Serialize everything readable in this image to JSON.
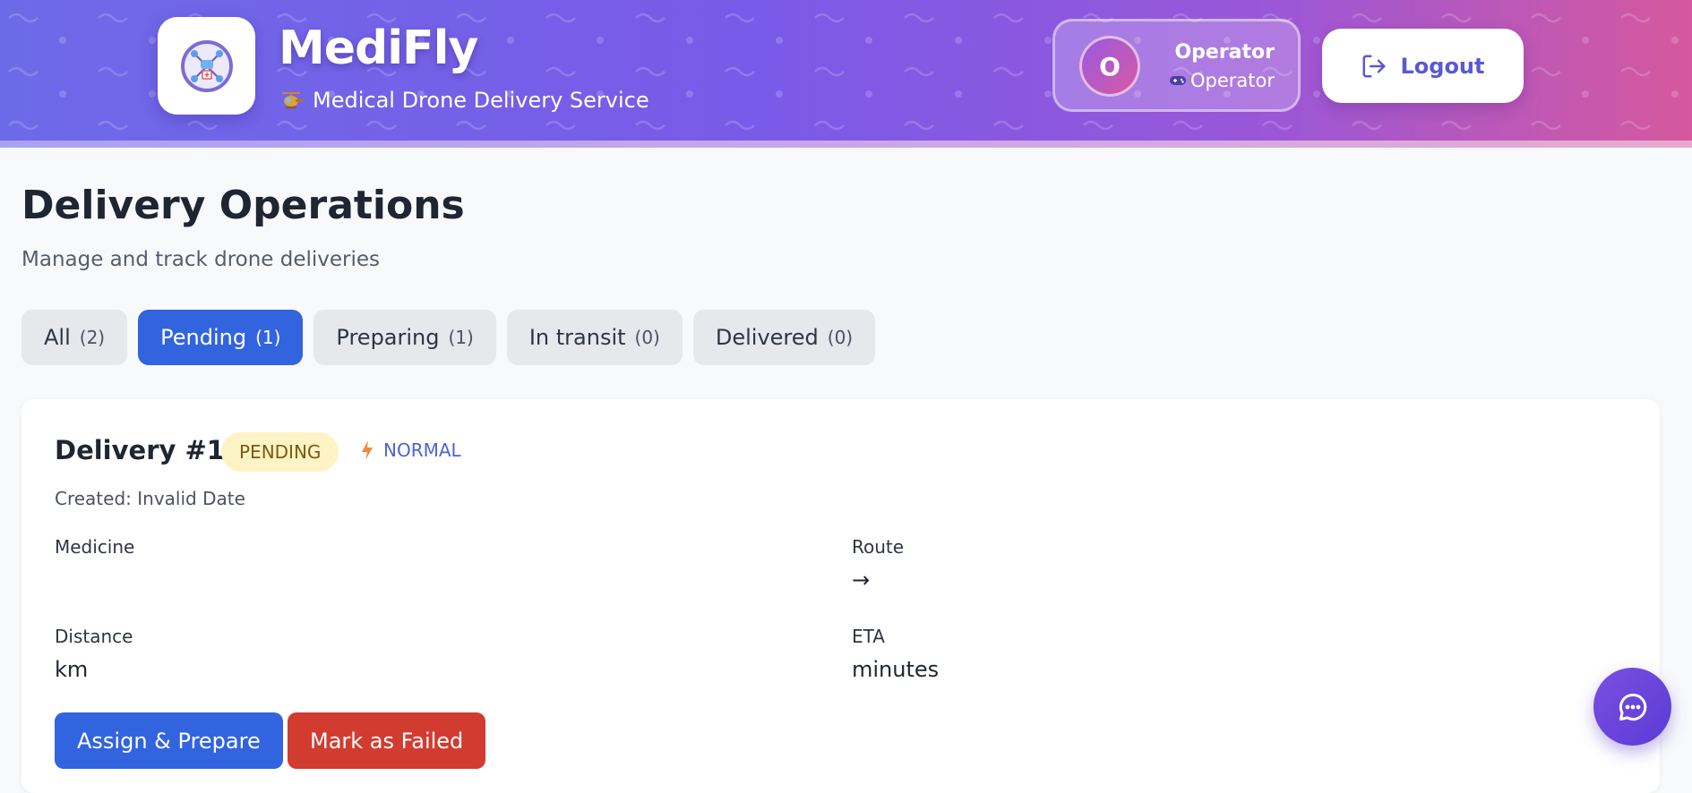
{
  "header": {
    "brand": "MediFly",
    "subtitle": "Medical Drone Delivery Service",
    "user": {
      "avatar_initial": "O",
      "name": "Operator",
      "role": "Operator"
    },
    "logout_label": "Logout"
  },
  "page": {
    "title": "Delivery Operations",
    "subtitle": "Manage and track drone deliveries"
  },
  "tabs": [
    {
      "label": "All",
      "count": "(2)",
      "active": false
    },
    {
      "label": "Pending",
      "count": "(1)",
      "active": true
    },
    {
      "label": "Preparing",
      "count": "(1)",
      "active": false
    },
    {
      "label": "In transit",
      "count": "(0)",
      "active": false
    },
    {
      "label": "Delivered",
      "count": "(0)",
      "active": false
    }
  ],
  "delivery": {
    "title": "Delivery #1",
    "status": "PENDING",
    "priority": "NORMAL",
    "created": "Created: Invalid Date",
    "fields": {
      "medicine_label": "Medicine",
      "medicine_value": "",
      "route_label": "Route",
      "route_value": "→",
      "distance_label": "Distance",
      "distance_value": "km",
      "eta_label": "ETA",
      "eta_value": "minutes"
    },
    "actions": {
      "assign_label": "Assign & Prepare",
      "fail_label": "Mark as Failed"
    }
  },
  "colors": {
    "primary": "#3264e0",
    "danger": "#d23b30",
    "pending_bg": "#fdf3c4",
    "header_gradient_start": "#6d6ae8",
    "header_gradient_end": "#d6589e"
  },
  "icons": {
    "logo": "drone-logo-icon",
    "subtitle": "helicopter-icon",
    "role": "gamepad-icon",
    "logout": "logout-icon",
    "priority": "lightning-icon",
    "chat": "chat-bubble-icon"
  }
}
